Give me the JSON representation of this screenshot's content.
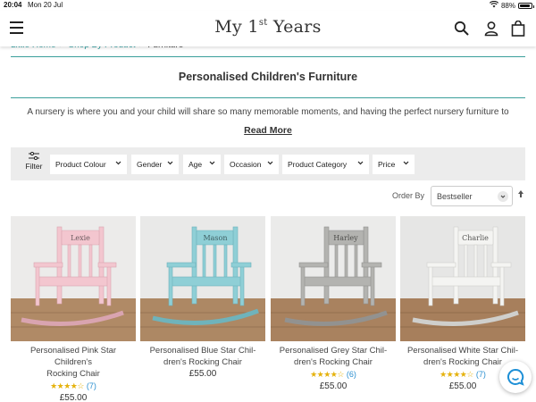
{
  "status_bar": {
    "time": "20:04",
    "date": "Mon 20 Jul",
    "battery": "88%",
    "battery_level": 0.88
  },
  "header": {
    "logo_main": "My 1",
    "logo_sup": "st",
    "logo_tail": " Years",
    "icons": [
      "menu-icon",
      "search-icon",
      "account-icon",
      "bag-icon"
    ]
  },
  "breadcrumb": {
    "items": [
      "Little Home",
      "Shop By Product"
    ],
    "current": "Furniture",
    "separator": ">"
  },
  "page": {
    "title": "Personalised Children's Furniture",
    "intro": "A nursery is where you and your child will share so many memorable moments, and having the perfect nursery furniture to",
    "read_more": "Read More"
  },
  "filters": {
    "toggle_label": "Filter",
    "chips": [
      "Product Colour",
      "Gender",
      "Age",
      "Occasion",
      "Product Category",
      "Price"
    ]
  },
  "sort": {
    "label": "Order By",
    "selected": "Bestseller"
  },
  "products": [
    {
      "name_line1": "Personalised Pink Star Children's",
      "name_line2": "Rocking Chair",
      "stars": "★★★★☆",
      "rating": 4,
      "count": "(7)",
      "price": "£55.00",
      "engraving": "Lexie",
      "color": "#f3c6cf"
    },
    {
      "name_line1": "Personalised Blue Star Chil-",
      "name_line2": "dren's Rocking Chair",
      "stars": "",
      "rating": null,
      "count": "",
      "price": "£55.00",
      "engraving": "Mason",
      "color": "#8fcfd6"
    },
    {
      "name_line1": "Personalised Grey Star Chil-",
      "name_line2": "dren's Rocking Chair",
      "stars": "★★★★☆",
      "rating": 4,
      "count": "(6)",
      "price": "£55.00",
      "engraving": "Harley",
      "color": "#b3b3b0"
    },
    {
      "name_line1": "Personalised White Star Chil-",
      "name_line2": "dren's Rocking Chair",
      "stars": "★★★★☆",
      "rating": 4,
      "count": "(7)",
      "price": "£55.00",
      "engraving": "Charlie",
      "color": "#f4f4f2"
    }
  ],
  "colors": {
    "accent": "#2a9d9f",
    "star": "#e5b20d",
    "filter_bg": "#ececec",
    "chat": "#1d8fd6"
  }
}
